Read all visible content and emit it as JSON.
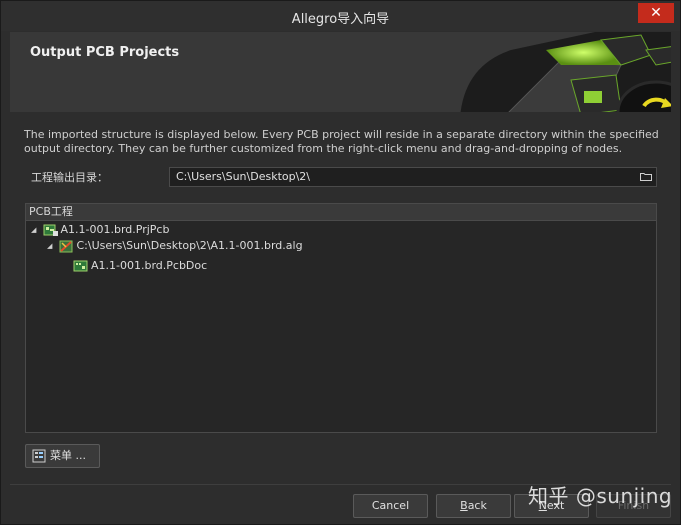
{
  "window": {
    "title": "Allegro导入向导"
  },
  "banner": {
    "title": "Output PCB Projects"
  },
  "description": "The imported structure is displayed below. Every PCB project will reside in a separate directory within the specified output directory. They can be further customized from the right-click menu and drag-and-dropping of nodes.",
  "output": {
    "label": "工程输出目录：",
    "value": "C:\\Users\\Sun\\Desktop\\2\\"
  },
  "tree": {
    "header": "PCB工程",
    "nodes": [
      {
        "label": "A1.1-001.brd.PrjPcb",
        "icon": "prjpcb-icon",
        "expanded": true
      },
      {
        "label": "C:\\Users\\Sun\\Desktop\\2\\A1.1-001.brd.alg",
        "icon": "allegro-file-icon",
        "expanded": true
      },
      {
        "label": "A1.1-001.brd.PcbDoc",
        "icon": "pcbdoc-icon"
      }
    ]
  },
  "menu_button": {
    "label": "菜单 ..."
  },
  "footer": {
    "cancel": "Cancel",
    "back_first": "B",
    "back_rest": "ack",
    "next_first": "N",
    "next_rest": "ext",
    "finish": "Finish"
  },
  "watermark": "知乎 @sunjing",
  "colors": {
    "accent_green": "#a9e33a",
    "close_red": "#c42b1c"
  }
}
